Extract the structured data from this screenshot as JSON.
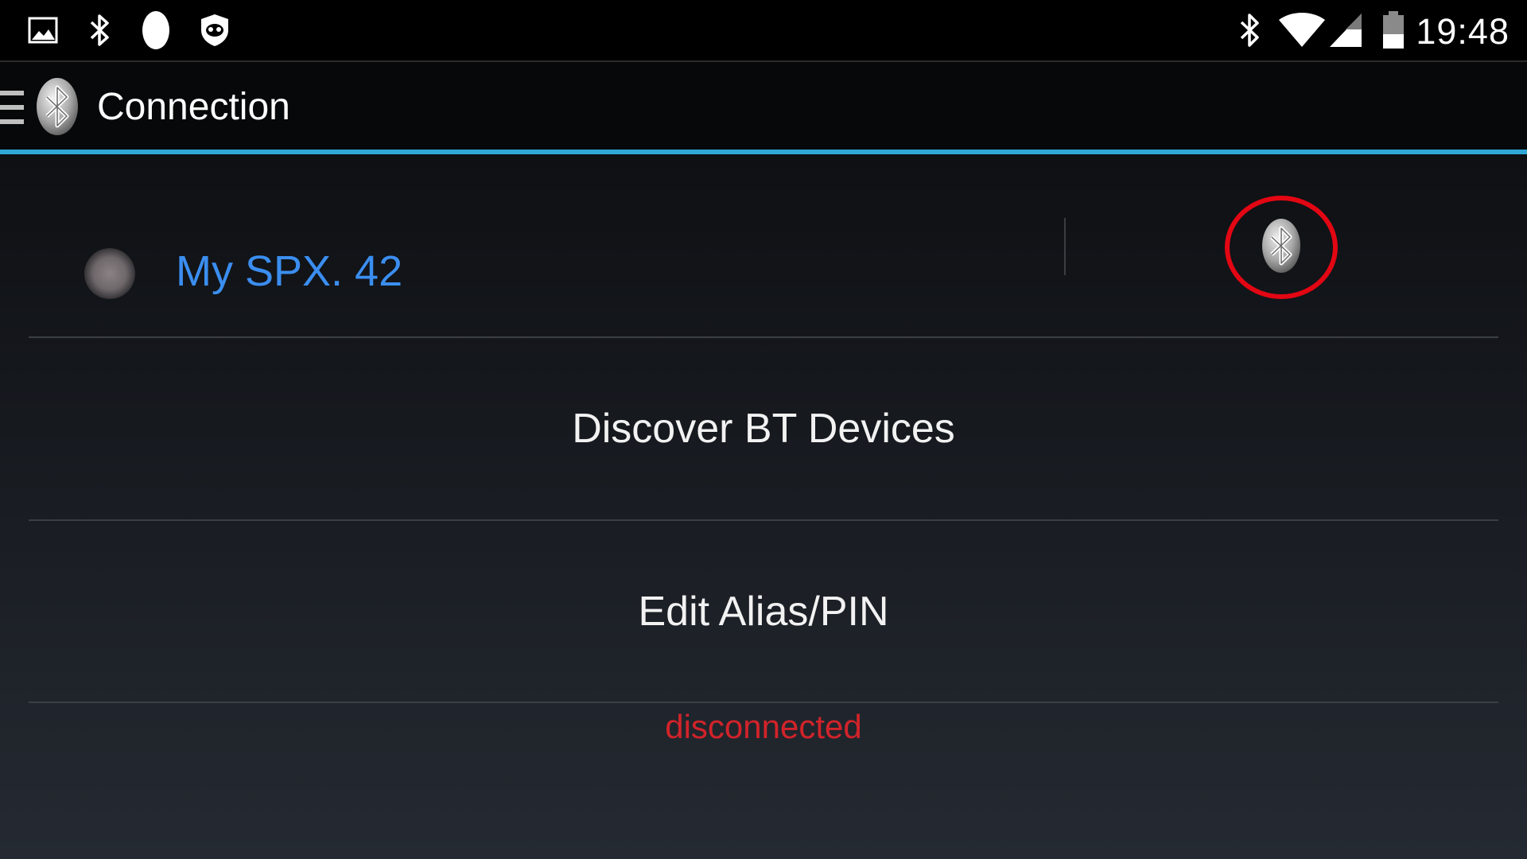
{
  "status_bar": {
    "time": "19:48",
    "left_icons": [
      "image-icon",
      "bluetooth-icon",
      "oval-notification-icon",
      "privacy-guard-icon"
    ],
    "right_icons": [
      "bluetooth-icon",
      "wifi-icon",
      "signal-icon",
      "battery-icon"
    ]
  },
  "action_bar": {
    "title": "Connection",
    "accent_color": "#2fa7d7"
  },
  "device": {
    "name": "My SPX. 42",
    "name_color": "#3b8ef0",
    "status_dot_color": "#7c7578",
    "bt_button_highlight_color": "#e30613"
  },
  "menu": {
    "discover_label": "Discover BT Devices",
    "edit_label": "Edit Alias/PIN"
  },
  "connection": {
    "status": "disconnected",
    "status_color": "#d2232a"
  }
}
